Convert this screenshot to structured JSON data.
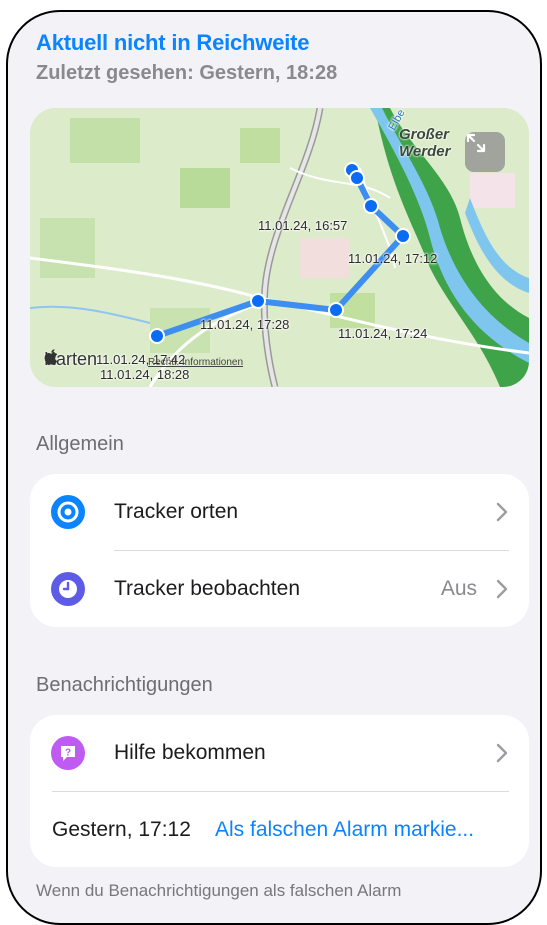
{
  "header": {
    "status": "Aktuell nicht in Reichweite",
    "last_seen": "Zuletzt gesehen: Gestern, 18:28"
  },
  "map": {
    "place_line1": "Großer",
    "place_line2": "Werder",
    "river_label": "Elbe",
    "attribution": "Karten",
    "legal": "Rechtl. Informationen",
    "timestamps": [
      "11.01.24, 16:57",
      "11.01.24, 17:12",
      "11.01.24, 17:28",
      "11.01.24, 17:24",
      "11.01.24, 17:42",
      "11.01.24, 18:28"
    ],
    "track_color": "#3d8ef0",
    "point_color": "#0a6cf5"
  },
  "sections": {
    "general": "Allgemein",
    "notifications": "Benachrichtigungen"
  },
  "general": {
    "locate_label": "Tracker orten",
    "watch_label": "Tracker beobachten",
    "watch_value": "Aus"
  },
  "notifications": {
    "help_label": "Hilfe bekommen",
    "alarm_time": "Gestern, 17:12",
    "alarm_link": "Als falschen Alarm markie..."
  },
  "footer": "Wenn du Benachrichtigungen als falschen Alarm",
  "colors": {
    "accent": "#0a84ff",
    "locate_icon": "#0a84ff",
    "watch_icon": "#5e5ce6",
    "help_icon": "#bf5af2"
  },
  "icons": {
    "locate": "target-icon",
    "watch": "clock-icon",
    "help": "question-bubble-icon",
    "expand": "expand-icon",
    "chevron": "chevron-right-icon",
    "apple": "apple-logo-icon"
  }
}
